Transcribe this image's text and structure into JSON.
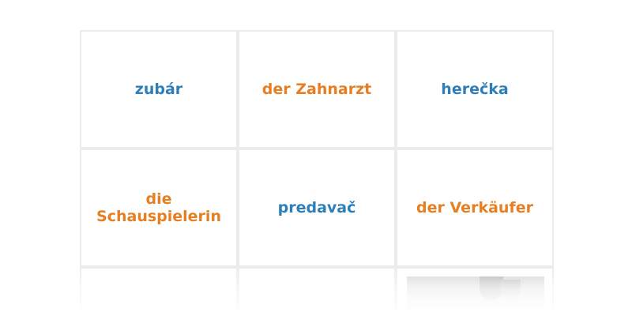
{
  "cards": [
    {
      "text": "zubár",
      "lang": "sk"
    },
    {
      "text": "der Zahnarzt",
      "lang": "de"
    },
    {
      "text": "herečka",
      "lang": "sk"
    },
    {
      "text": "die Schauspielerin",
      "lang": "de"
    },
    {
      "text": "predavač",
      "lang": "sk"
    },
    {
      "text": "der Verkäufer",
      "lang": "de"
    }
  ],
  "colors": {
    "slovak_text": "#2e7fb8",
    "german_text": "#e67e22",
    "card_border": "#ececec"
  }
}
